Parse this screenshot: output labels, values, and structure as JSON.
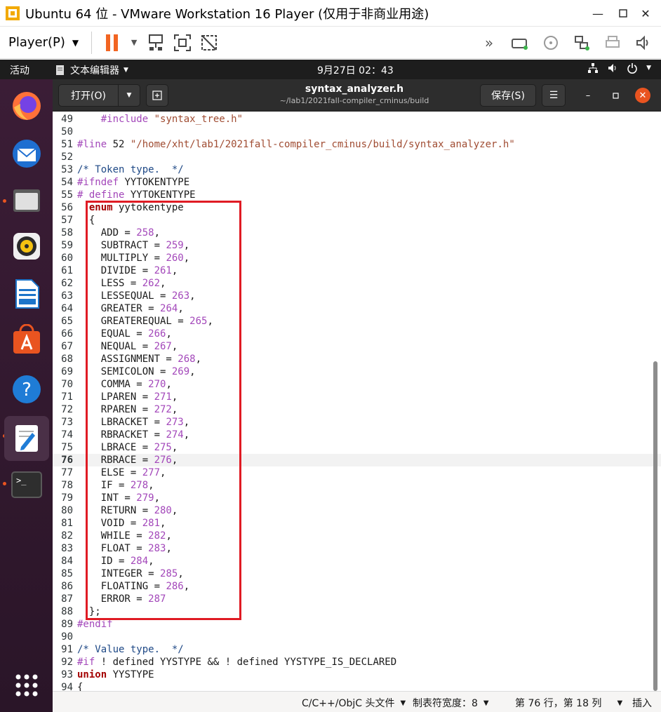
{
  "vm_window": {
    "title": "Ubuntu 64 位 - VMware Workstation 16 Player (仅用于非商业用途)",
    "minimize_icon": "minimize-icon",
    "maximize_icon": "maximize-icon",
    "close_icon": "close-icon"
  },
  "vm_toolbar": {
    "player_menu_label": "Player(P)",
    "icons": [
      "pause-icon",
      "network-icon",
      "fullscreen-icon",
      "unity-icon"
    ],
    "right_icons": [
      "fast-forward-icon",
      "hard-disk-icon",
      "cd-rom-icon",
      "network-adapter-icon",
      "printer-icon",
      "sound-icon"
    ]
  },
  "gnome_topbar": {
    "activities_label": "活动",
    "app_menu_label": "文本编辑器",
    "clock": "9月27日  02：43"
  },
  "dock": {
    "items": [
      "firefox-icon",
      "thunderbird-icon",
      "files-icon",
      "rhythmbox-icon",
      "libreoffice-writer-icon",
      "software-icon",
      "help-icon",
      "text-editor-icon",
      "terminal-icon",
      "show-applications-icon"
    ]
  },
  "editor_header": {
    "open_label": "打开(O)",
    "save_label": "保存(S)",
    "doc_title": "syntax_analyzer.h",
    "doc_path": "~/lab1/2021fall-compiler_cminus/build"
  },
  "code": {
    "current_line": 76,
    "lines": [
      {
        "n": 49,
        "t": "    #include \"syntax_tree.h\""
      },
      {
        "n": 50,
        "t": ""
      },
      {
        "n": 51,
        "t": "#line 52 \"/home/xht/lab1/2021fall-compiler_cminus/build/syntax_analyzer.h\""
      },
      {
        "n": 52,
        "t": ""
      },
      {
        "n": 53,
        "t": "/* Token type.  */"
      },
      {
        "n": 54,
        "t": "#ifndef YYTOKENTYPE"
      },
      {
        "n": 55,
        "t": "# define YYTOKENTYPE"
      },
      {
        "n": 56,
        "t": "  enum yytokentype"
      },
      {
        "n": 57,
        "t": "  {"
      },
      {
        "n": 58,
        "t": "    ADD = 258,"
      },
      {
        "n": 59,
        "t": "    SUBTRACT = 259,"
      },
      {
        "n": 60,
        "t": "    MULTIPLY = 260,"
      },
      {
        "n": 61,
        "t": "    DIVIDE = 261,"
      },
      {
        "n": 62,
        "t": "    LESS = 262,"
      },
      {
        "n": 63,
        "t": "    LESSEQUAL = 263,"
      },
      {
        "n": 64,
        "t": "    GREATER = 264,"
      },
      {
        "n": 65,
        "t": "    GREATEREQUAL = 265,"
      },
      {
        "n": 66,
        "t": "    EQUAL = 266,"
      },
      {
        "n": 67,
        "t": "    NEQUAL = 267,"
      },
      {
        "n": 68,
        "t": "    ASSIGNMENT = 268,"
      },
      {
        "n": 69,
        "t": "    SEMICOLON = 269,"
      },
      {
        "n": 70,
        "t": "    COMMA = 270,"
      },
      {
        "n": 71,
        "t": "    LPAREN = 271,"
      },
      {
        "n": 72,
        "t": "    RPAREN = 272,"
      },
      {
        "n": 73,
        "t": "    LBRACKET = 273,"
      },
      {
        "n": 74,
        "t": "    RBRACKET = 274,"
      },
      {
        "n": 75,
        "t": "    LBRACE = 275,"
      },
      {
        "n": 76,
        "t": "    RBRACE = 276,"
      },
      {
        "n": 77,
        "t": "    ELSE = 277,"
      },
      {
        "n": 78,
        "t": "    IF = 278,"
      },
      {
        "n": 79,
        "t": "    INT = 279,"
      },
      {
        "n": 80,
        "t": "    RETURN = 280,"
      },
      {
        "n": 81,
        "t": "    VOID = 281,"
      },
      {
        "n": 82,
        "t": "    WHILE = 282,"
      },
      {
        "n": 83,
        "t": "    FLOAT = 283,"
      },
      {
        "n": 84,
        "t": "    ID = 284,"
      },
      {
        "n": 85,
        "t": "    INTEGER = 285,"
      },
      {
        "n": 86,
        "t": "    FLOATING = 286,"
      },
      {
        "n": 87,
        "t": "    ERROR = 287"
      },
      {
        "n": 88,
        "t": "  };"
      },
      {
        "n": 89,
        "t": "#endif"
      },
      {
        "n": 90,
        "t": ""
      },
      {
        "n": 91,
        "t": "/* Value type.  */"
      },
      {
        "n": 92,
        "t": "#if ! defined YYSTYPE && ! defined YYSTYPE_IS_DECLARED"
      },
      {
        "n": 93,
        "t": "union YYSTYPE"
      },
      {
        "n": 94,
        "t": "{"
      }
    ]
  },
  "statusbar": {
    "language": "C/C++/ObjC 头文件",
    "tab_width": "制表符宽度：8",
    "cursor_position": "第 76 行，第 18 列",
    "insert_mode": "插入"
  }
}
